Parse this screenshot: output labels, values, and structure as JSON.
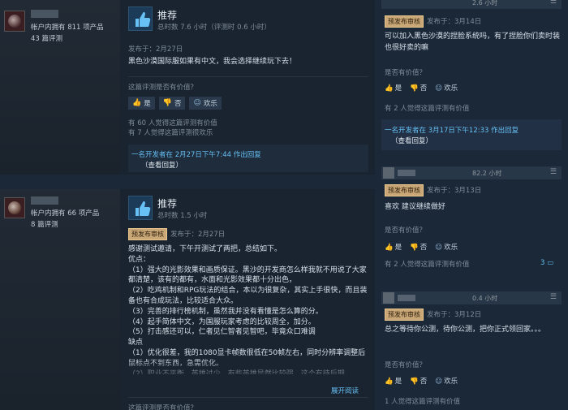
{
  "left_reviews": [
    {
      "author": {
        "products_line": "帐户内拥有 811 项产品",
        "reviews_line": "43 篇评测"
      },
      "title": "推荐",
      "hours": "总时数 7.6 小时（评测时 0.6 小时）",
      "posted": "发布于：2月27日",
      "body": "黑色沙漠国际服如果有中文，我会选择继续玩下去！",
      "helpful_question": "这篇评测是否有价值？",
      "votes": {
        "yes": "是",
        "no": "否",
        "funny": "欢乐"
      },
      "stats": [
        "有 60 人觉得这篇评测有价值",
        "有 7 人觉得这篇评测很欢乐"
      ],
      "dev_response": {
        "line": "一名开发者在 2月27日下午7:44 作出回复",
        "view": "（查看回复）"
      }
    },
    {
      "author": {
        "products_line": "帐户内拥有 66 项产品",
        "reviews_line": "8 篇评测"
      },
      "title": "推荐",
      "hours": "总时数 1.5 小时",
      "badge": "预发布审核",
      "posted": "发布于：2月27日",
      "body": "感谢测试邀请，下午开测试了两把，总结如下。\n优点：\n（1）强大的光影效果和画质保证。黑沙的开发商怎么样我就不用说了大家都清楚，该有的都有，水面和光影效果都十分出色，\n（2）吃鸡机制和RPG玩法的结合，本以为很复杂，其实上手很快，而且装备也有合成玩法，比较适合大众。\n（3）完善的排行榜机制，虽然我并没有看懂是怎么算的分。\n（4）起手简体中文，为国服玩家考虑的比较周全，加分。\n（5）打击感还可以，仁者见仁智者见智吧，毕竟众口难调\n缺点\n（1）优化很差，我的1080显卡帧数很低在50帧左右，同时分辨率调整后鼠标点不到东西，急需优化。\n（2）职业不平衡，英雄过少，有些英雄显然比较强，这个有待后期",
      "expand": "展开阅读",
      "helpful_question": "这篇评测是否有价值？"
    }
  ],
  "right_comments": [
    {
      "hours": "2.6 小时",
      "badge": "预发布审核",
      "posted": "发布于：3月14日",
      "text": "可以加入黑色沙漠的捏脸系统吗，有了捏脸你们卖时装也很好卖的嘛",
      "helpful_question": "是否有价值？",
      "votes": {
        "yes": "是",
        "no": "否",
        "funny": "欢乐"
      },
      "stat": "有 2 人觉得这篇评测有价值"
    },
    {
      "dev_line": "一名开发者在 3月17日下午12:33 作出回复",
      "dev_view": "（查看回复）"
    },
    {
      "hours": "82.2 小时",
      "badge": "预发布审核",
      "posted": "发布于：3月13日",
      "text": "喜欢 建议继续做好",
      "helpful_question": "是否有价值？",
      "votes": {
        "yes": "是",
        "no": "否",
        "funny": "欢乐"
      },
      "stat": "有 2 人觉得这篇评测有价值",
      "count": "3"
    },
    {
      "hours": "0.4 小时",
      "badge": "预发布审核",
      "posted": "发布于：3月12日",
      "text": "总之等待你公测，待你公测，把你正式领回家。。。",
      "helpful_question": "是否有价值？",
      "votes": {
        "yes": "是",
        "no": "否",
        "funny": "欢乐"
      },
      "stat": "1 人觉得这篇评测有价值"
    }
  ],
  "icons": {
    "thumbs_up": "thumbs-up-icon",
    "thumbs_down": "thumbs-down-icon",
    "smile": "smile-icon",
    "menu": "hamburger-icon"
  }
}
